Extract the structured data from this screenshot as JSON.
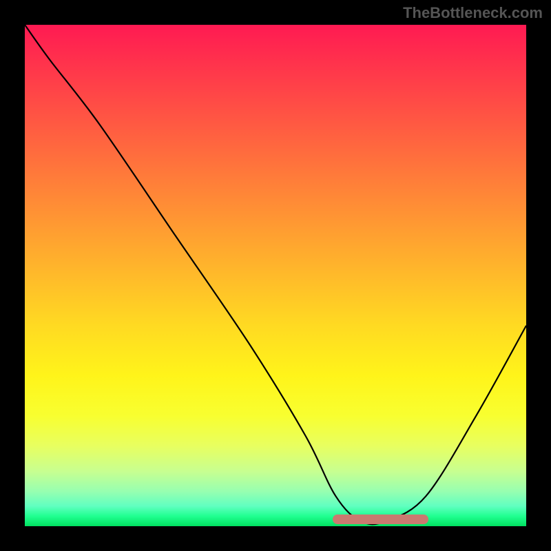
{
  "watermark": "TheBottleneck.com",
  "chart_data": {
    "type": "line",
    "title": "",
    "xlabel": "",
    "ylabel": "",
    "xlim": [
      0,
      100
    ],
    "ylim": [
      0,
      100
    ],
    "background_gradient": {
      "top_color": "#ff1a52",
      "mid_color": "#ffda22",
      "bottom_color": "#00e060",
      "meaning": "red high to green low (bottleneck severity)"
    },
    "series": [
      {
        "name": "bottleneck-curve",
        "x": [
          0,
          5,
          15,
          30,
          45,
          56,
          62,
          67,
          72,
          80,
          90,
          100
        ],
        "values": [
          100,
          93,
          80,
          58,
          36,
          18,
          6,
          1,
          1,
          6,
          22,
          40
        ]
      }
    ],
    "optimal_range": {
      "x_start": 62,
      "x_end": 80,
      "y": 1
    },
    "annotations": []
  }
}
